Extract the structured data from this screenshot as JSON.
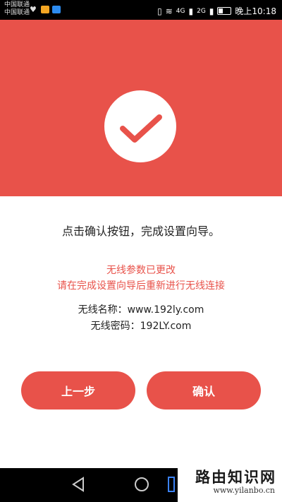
{
  "status_bar": {
    "carrier_1": "中国联通",
    "carrier_2": "中国联通",
    "network_1": "4G",
    "network_2": "2G",
    "time": "晚上10:18"
  },
  "icons": {
    "check": "checkmark-icon",
    "back": "triangle-back-icon",
    "home": "circle-home-icon",
    "recent": "square-recent-icon"
  },
  "main": {
    "instruction": "点击确认按钮，完成设置向导。",
    "notice_line_1": "无线参数已更改",
    "notice_line_2": "请在完成设置向导后重新进行无线连接",
    "wifi_name": "无线名称：www.192ly.com",
    "wifi_password": "无线密码：192LY.com"
  },
  "buttons": {
    "prev_label": "上一步",
    "confirm_label": "确认"
  },
  "watermark": {
    "title": "路由知识网",
    "url": "www.yilanbo.cn"
  },
  "colors": {
    "accent": "#e8524a",
    "text": "#222222"
  }
}
